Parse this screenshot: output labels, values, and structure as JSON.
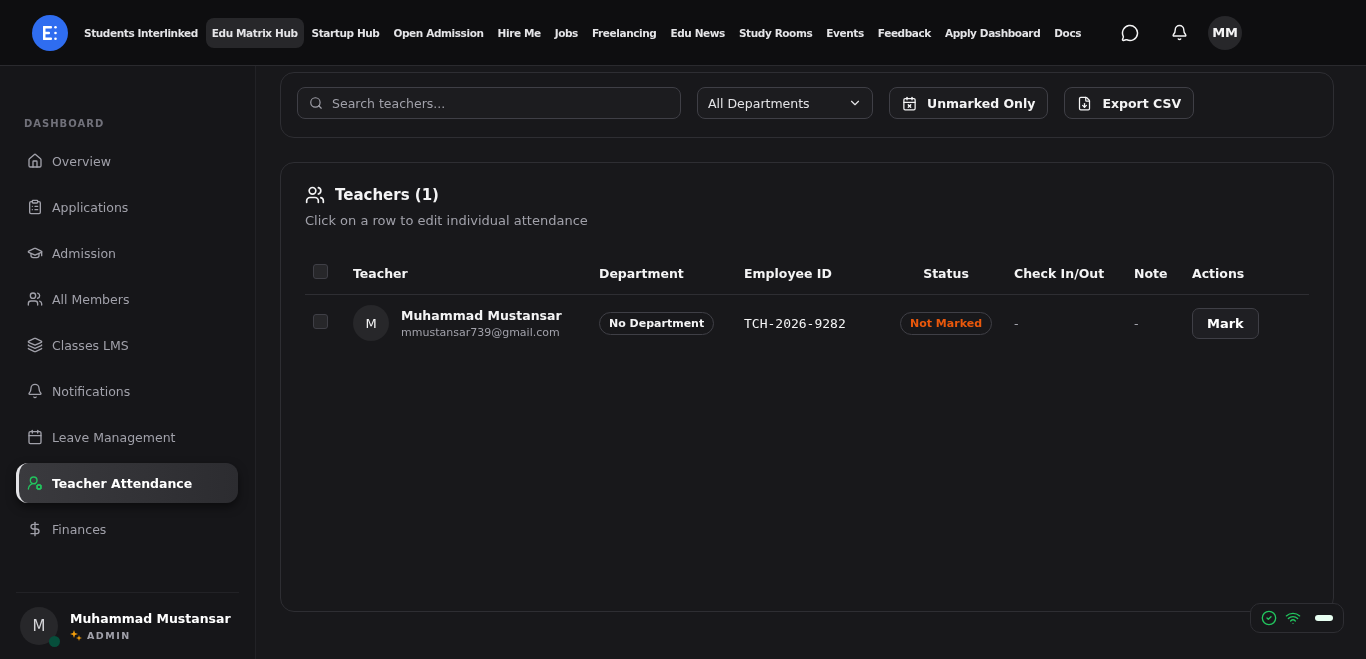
{
  "header": {
    "nav": [
      {
        "label": "Students Interlinked",
        "selected": false
      },
      {
        "label": "Edu Matrix Hub",
        "selected": true
      },
      {
        "label": "Startup Hub",
        "selected": false
      },
      {
        "label": "Open Admission",
        "selected": false
      },
      {
        "label": "Hire Me",
        "selected": false
      },
      {
        "label": "Jobs",
        "selected": false
      },
      {
        "label": "Freelancing",
        "selected": false
      },
      {
        "label": "Edu News",
        "selected": false
      },
      {
        "label": "Study Rooms",
        "selected": false
      },
      {
        "label": "Events",
        "selected": false
      },
      {
        "label": "Feedback",
        "selected": false
      },
      {
        "label": "Apply Dashboard",
        "selected": false
      },
      {
        "label": "Docs",
        "selected": false
      }
    ],
    "avatar": "MM"
  },
  "sidebar": {
    "section": "DASHBOARD",
    "items": [
      {
        "label": "Overview",
        "selected": false
      },
      {
        "label": "Applications",
        "selected": false
      },
      {
        "label": "Admission",
        "selected": false
      },
      {
        "label": "All Members",
        "selected": false
      },
      {
        "label": "Classes LMS",
        "selected": false
      },
      {
        "label": "Notifications",
        "selected": false
      },
      {
        "label": "Leave Management",
        "selected": false
      },
      {
        "label": "Teacher Attendance",
        "selected": true
      },
      {
        "label": "Finances",
        "selected": false
      }
    ],
    "user": {
      "initial": "M",
      "name": "Muhammad Mustansar",
      "role": "ADMIN",
      "online": true
    }
  },
  "filters": {
    "search": {
      "placeholder": "Search teachers..."
    },
    "department": "All Departments",
    "buttons": [
      "Unmarked Only",
      "Export CSV"
    ]
  },
  "teachers": {
    "title": "Teachers (1)",
    "subtitle": "Click on a row to edit individual attendance",
    "all_checked": false,
    "columns": [
      "Teacher",
      "Department",
      "Employee ID",
      "Status",
      "Check In/Out",
      "Note",
      "Actions"
    ],
    "rows": [
      {
        "checked": false,
        "initial": "M",
        "name": "Muhammad Mustansar",
        "email": "mmustansar739@gmail.com",
        "department": "No Department",
        "employee_id": "TCH-2026-9282",
        "status": {
          "label": "Not Marked",
          "color": "#ea580c"
        },
        "check_in_out": "-",
        "note": "-",
        "action": "Mark"
      }
    ]
  }
}
